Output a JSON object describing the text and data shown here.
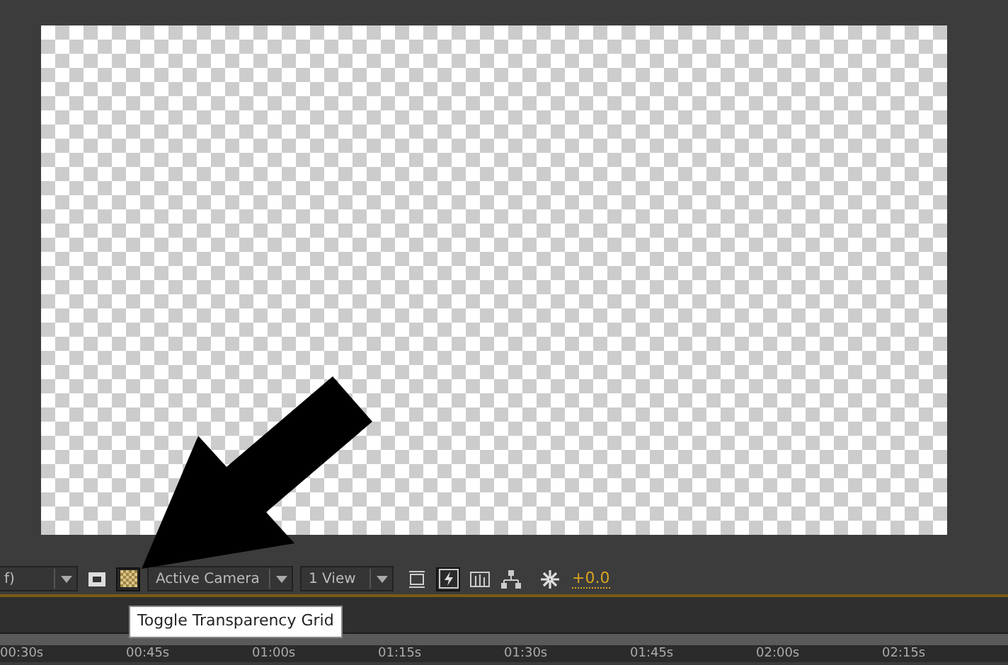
{
  "viewer": {
    "transparency_grid": true
  },
  "toolbar": {
    "resolution": "f)",
    "grid_toggle_on": true,
    "view": "Active Camera",
    "layout": "1 View",
    "fast_previews_on": true,
    "exposure": "+0.0"
  },
  "tooltip": "Toggle Transparency Grid",
  "ruler": [
    "00:30s",
    "00:45s",
    "01:00s",
    "01:15s",
    "01:30s",
    "01:45s",
    "02:00s",
    "02:15s"
  ]
}
